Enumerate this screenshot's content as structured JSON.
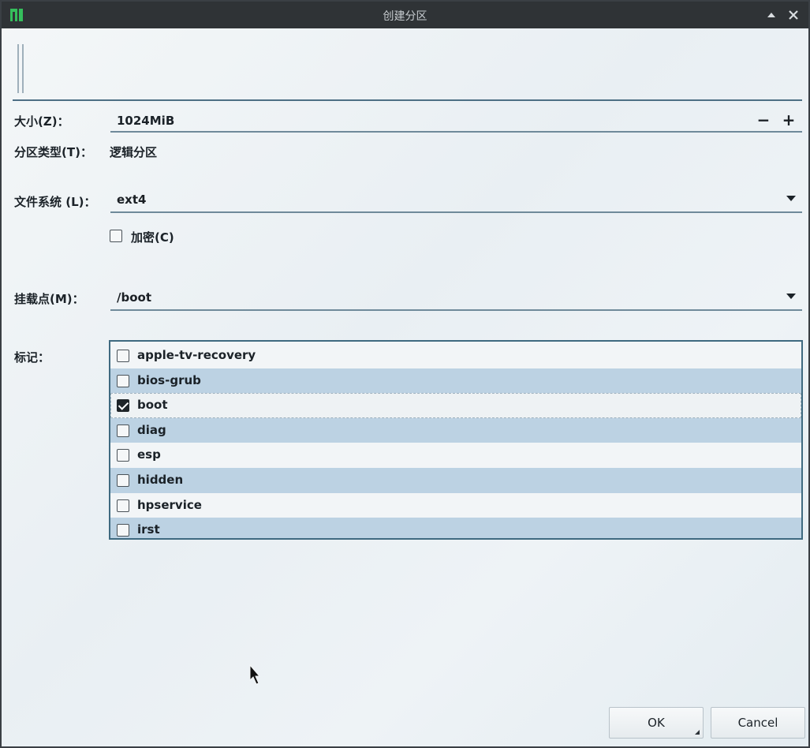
{
  "window": {
    "title": "创建分区"
  },
  "form": {
    "size_label": "大小(Z)：",
    "size_value": "1024MiB",
    "size_decrease": "−",
    "size_increase": "+",
    "partition_type_label": "分区类型(T)：",
    "partition_type_value": "逻辑分区",
    "filesystem_label": "文件系统 (L)：",
    "filesystem_value": "ext4",
    "encrypt_label": "加密(C)",
    "encrypt_checked": false,
    "mountpoint_label": "挂载点(M)：",
    "mountpoint_value": "/boot",
    "flags_label": "标记："
  },
  "flags": [
    {
      "label": "apple-tv-recovery",
      "checked": false
    },
    {
      "label": "bios-grub",
      "checked": false
    },
    {
      "label": "boot",
      "checked": true
    },
    {
      "label": "diag",
      "checked": false
    },
    {
      "label": "esp",
      "checked": false
    },
    {
      "label": "hidden",
      "checked": false
    },
    {
      "label": "hpservice",
      "checked": false
    },
    {
      "label": "irst",
      "checked": false
    }
  ],
  "buttons": {
    "ok": "OK",
    "cancel": "Cancel"
  },
  "colors": {
    "titlebar": "#2f3336",
    "accent_border": "#3f6a80",
    "alt_row": "#bcd2e3"
  }
}
